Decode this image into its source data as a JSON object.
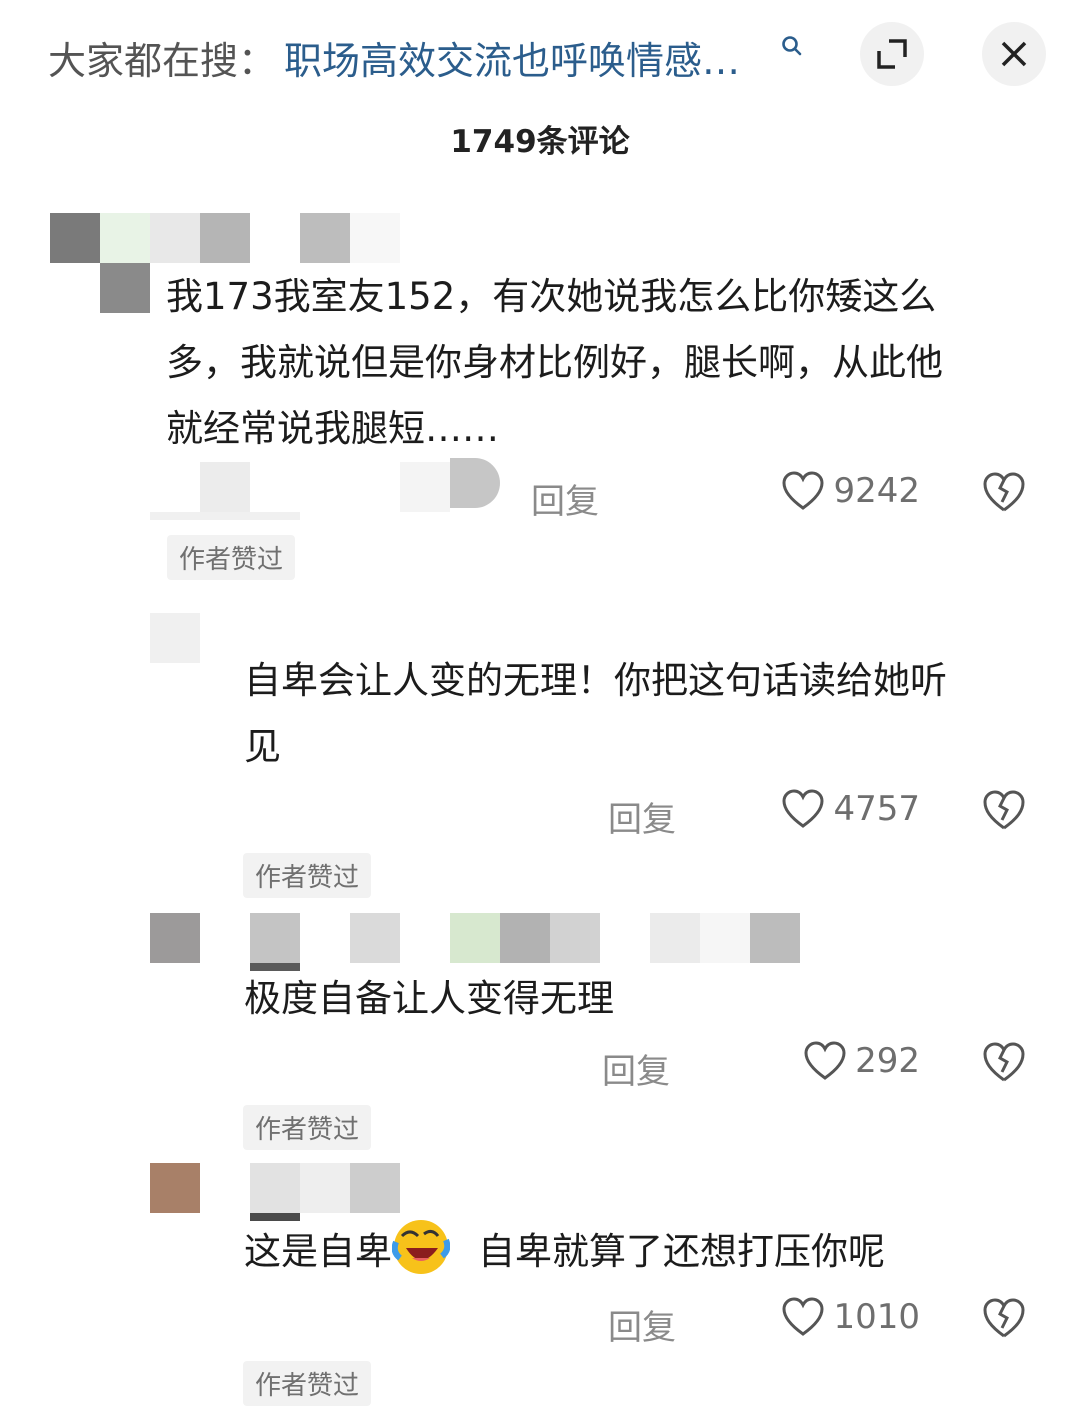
{
  "header": {
    "search_prefix": "大家都在搜：",
    "search_query": "职场高效交流也呼唤情感…",
    "expand_icon": "expand-icon",
    "close_icon": "close-icon"
  },
  "comment_count": "1749条评论",
  "comments": [
    {
      "text_lines": [
        "我173我室友152，有次她说我怎么比你矮这么",
        "多，我就说但是你身材比例好，腿长啊，从此他",
        "就经常说我腿短……"
      ],
      "reply_label": "回复",
      "likes": "9242",
      "badge": "作者赞过"
    },
    {
      "text_lines": [
        "自卑会让人变的无理！你把这句话读给她听",
        "见"
      ],
      "reply_label": "回复",
      "likes": "4757",
      "badge": "作者赞过"
    },
    {
      "text": "极度自备让人变得无理",
      "reply_label": "回复",
      "likes": "292",
      "badge": "作者赞过"
    },
    {
      "text_before_emoji": "这是自卑",
      "emoji": "laughing-crying-emoji",
      "text_after_emoji": "自卑就算了还想打压你呢",
      "reply_label": "回复",
      "likes": "1010",
      "badge": "作者赞过"
    }
  ],
  "colors": {
    "link": "#2b5d8c",
    "badge_bg": "#f2f2f2",
    "muted": "#8a8a8a"
  }
}
